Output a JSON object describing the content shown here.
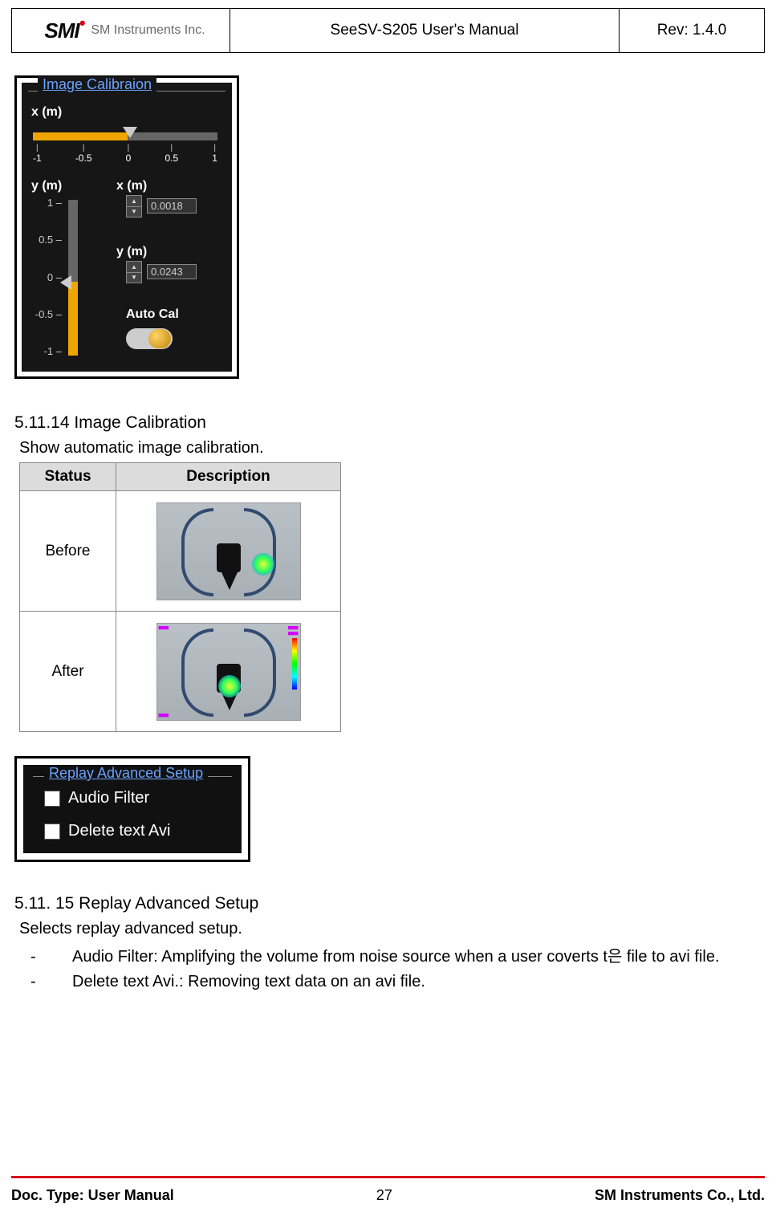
{
  "header": {
    "company": "SM Instruments Inc.",
    "logo_mark": "SMI",
    "title": "SeeSV-S205 User's Manual",
    "rev": "Rev: 1.4.0"
  },
  "calibration_panel": {
    "title": "Image Calibraion",
    "x_label": "x (m)",
    "y_label": "y (m)",
    "x_ticks": [
      "-1",
      "-0.5",
      "0",
      "0.5",
      "1"
    ],
    "y_ticks": [
      "1",
      "0.5",
      "0",
      "-0.5",
      "-1"
    ],
    "x_field_label": "x (m)",
    "y_field_label": "y (m)",
    "x_value": "0.0018",
    "y_value": "0.0243",
    "auto_label": "Auto Cal"
  },
  "section_calib": {
    "heading": "5.11.14 Image Calibration",
    "body": "Show automatic image calibration.",
    "table": {
      "col1": "Status",
      "col2": "Description",
      "rows": [
        "Before",
        "After"
      ]
    }
  },
  "replay_panel": {
    "title": "Replay Advanced Setup",
    "items": [
      "Audio Filter",
      "Delete text Avi"
    ]
  },
  "section_replay": {
    "heading": "5.11. 15 Replay Advanced Setup",
    "body": "Selects replay advanced setup.",
    "bullets": [
      "Audio Filter: Amplifying the volume from noise source when a user coverts t은  file to avi file.",
      "Delete text Avi.: Removing text data on an avi file."
    ]
  },
  "footer": {
    "left": "Doc. Type: User Manual",
    "center": "27",
    "right": "SM Instruments Co., Ltd."
  }
}
